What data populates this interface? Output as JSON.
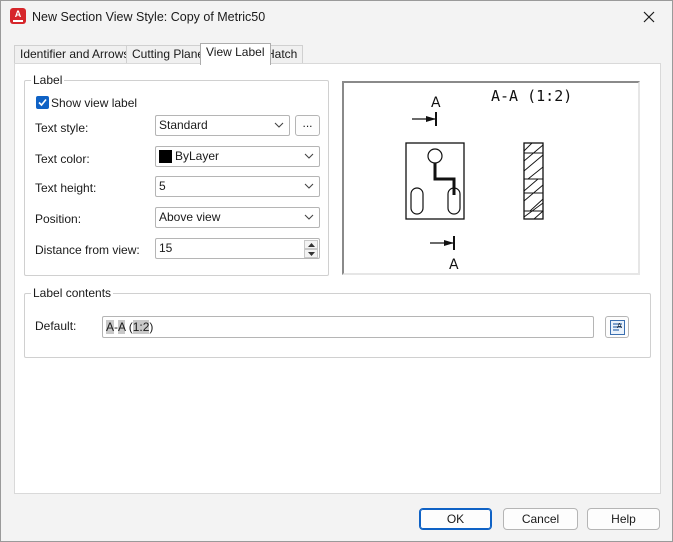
{
  "window": {
    "title": "New Section View Style: Copy of Metric50",
    "app_icon_letter": "A"
  },
  "tabs": [
    {
      "label": "Identifier and Arrows",
      "active": false
    },
    {
      "label": "Cutting Plane",
      "active": false
    },
    {
      "label": "View Label",
      "active": true
    },
    {
      "label": "Hatch",
      "active": false
    }
  ],
  "label_group": {
    "legend": "Label",
    "show_view_label": {
      "label": "Show view label",
      "checked": true
    },
    "text_style": {
      "label": "Text style:",
      "value": "Standard",
      "browse_label": "..."
    },
    "text_color": {
      "label": "Text color:",
      "value": "ByLayer",
      "swatch_color": "#000000"
    },
    "text_height": {
      "label": "Text height:",
      "value": "5"
    },
    "position": {
      "label": "Position:",
      "value": "Above view"
    },
    "distance_from_view": {
      "label": "Distance from view:",
      "value": "15"
    }
  },
  "preview": {
    "title_label": "A-A (1:2)",
    "top_identifier": "A",
    "bottom_identifier": "A"
  },
  "label_contents": {
    "legend": "Label contents",
    "default_label": "Default:",
    "default_value_highlight_1": "A",
    "default_value_sep": "-",
    "default_value_highlight_2": "A",
    "default_value_space": " (",
    "default_value_highlight_3": "1:2",
    "default_value_close": ")"
  },
  "buttons": {
    "ok": "OK",
    "cancel": "Cancel",
    "help": "Help"
  },
  "colors": {
    "accent": "#0f62c5",
    "app_icon": "#d6262b"
  }
}
